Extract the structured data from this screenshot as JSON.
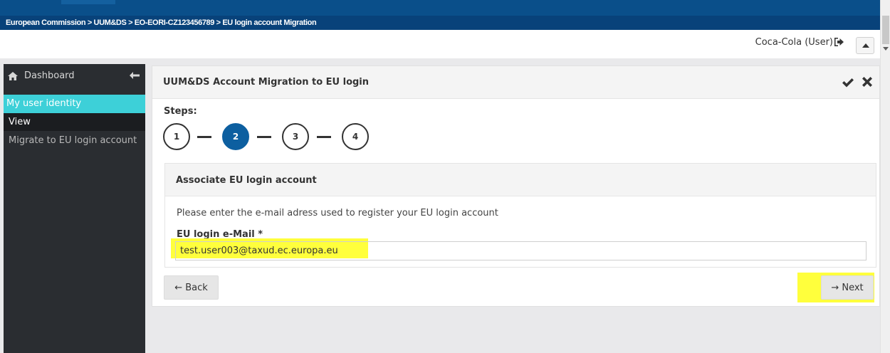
{
  "breadcrumb": "European Commission > UUM&DS > EO-EORI-CZ123456789 > EU login account Migration",
  "user": {
    "label": "Coca-Cola (User)"
  },
  "sidebar": {
    "dashboard": "Dashboard",
    "section": "My user identity",
    "items": [
      {
        "label": "View"
      },
      {
        "label": "Migrate to EU login account"
      }
    ]
  },
  "panel": {
    "title": "UUM&DS Account Migration to EU login",
    "steps_label": "Steps:",
    "steps": [
      "1",
      "2",
      "3",
      "4"
    ],
    "active_step": 2
  },
  "subpanel": {
    "title": "Associate EU login account",
    "instruction": "Please enter the e-mail adress used to register your EU login account",
    "field_label": "EU login e-Mail *",
    "field_value": "test.user003@taxud.ec.europa.eu"
  },
  "buttons": {
    "back": "← Back",
    "next": "→ Next"
  },
  "colors": {
    "brand_blue": "#0a4f8a",
    "accent_teal": "#3dd0d8",
    "active_step": "#0d5fa0",
    "highlight_yellow": "#ffff3c"
  },
  "icons": [
    "home-icon",
    "collapse-arrow-icon",
    "logout-icon",
    "scroll-top-icon",
    "check-icon",
    "close-icon"
  ]
}
